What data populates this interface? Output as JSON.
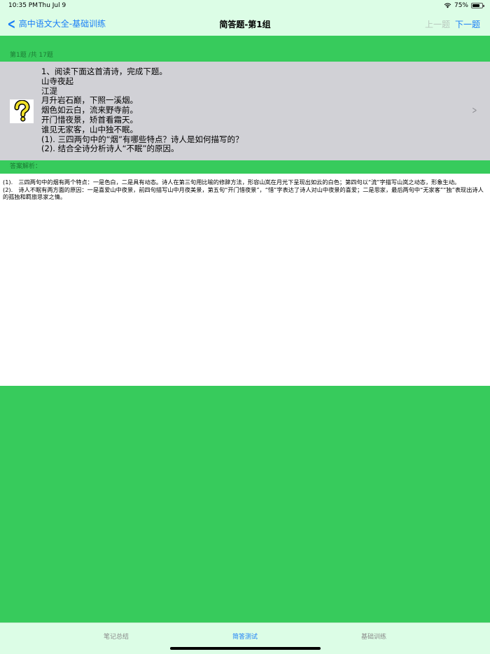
{
  "status": {
    "time": "10:35 PM",
    "date": "Thu Jul 9",
    "battery": "75%",
    "wifi_icon": "wifi-icon",
    "battery_level": 0.75
  },
  "nav": {
    "back_label": "高中语文大全-基础训练",
    "title": "简答题-第1组",
    "prev_label": "上一题",
    "next_label": "下一题"
  },
  "question": {
    "counter": "第1题 /共 17题",
    "icon": "question-mark-icon",
    "lines": [
      "1、阅读下面这首清诗，完成下题。",
      "山寺夜起",
      "江湜",
      "月升岩石巅，下照一溪烟。",
      "烟色如云白，流来野寺前。",
      "开门惜夜景，矫首看霜天。",
      "谁见无家客，山中独不眠。",
      "(1). 三四两句中的“烟”有哪些特点？诗人是如何描写的？",
      "(2). 结合全诗分析诗人“不眠”的原因。"
    ]
  },
  "answer": {
    "header": "答案解析：",
    "paragraphs": [
      "(1).　三四两句中的烟有两个特点：一是色白，二是具有动态。诗人在第三句用比喻的修辞方法，形容山岚在月光下呈现出如云的白色；第四句以“流”字描写山岚之动态，形象生动。",
      "(2).　诗人不眠有两方面的原因：一是喜爱山中夜景，前四句描写山中月夜美景，第五句“开门惜夜景”，“惜”字表达了诗人对山中夜景的喜爱；二是思家，最后两句中“无家客”“独”表现出诗人的孤独和羁旅思家之情。"
    ]
  },
  "tabs": [
    {
      "label": "笔记总结",
      "active": false
    },
    {
      "label": "简答测试",
      "active": true
    },
    {
      "label": "基础训练",
      "active": false
    }
  ],
  "colors": {
    "accent": "#1a7ef7",
    "background_green": "#37cb5c",
    "bar_background": "#dcfde6",
    "question_row": "#d1d1d6"
  }
}
